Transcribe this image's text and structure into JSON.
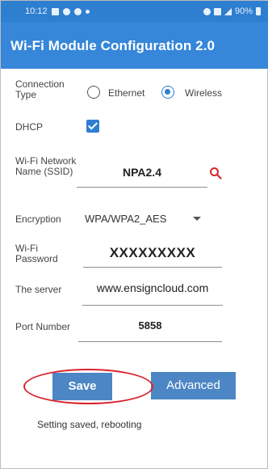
{
  "status_bar": {
    "time": "10:12",
    "battery": "90%"
  },
  "app_bar": {
    "title": "Wi-Fi Module Configuration 2.0"
  },
  "form": {
    "connection_type": {
      "label": "Connection Type",
      "options": [
        "Ethernet",
        "Wireless"
      ],
      "selected": "Wireless"
    },
    "dhcp": {
      "label": "DHCP",
      "checked": true
    },
    "ssid": {
      "label": "Wi-Fi Network Name (SSID)",
      "value": "NPA2.4"
    },
    "encryption": {
      "label": "Encryption",
      "value": "WPA/WPA2_AES"
    },
    "password": {
      "label": "Wi-Fi Password",
      "value": "XXXXXXXXX"
    },
    "server": {
      "label": "The server",
      "value": "www.ensigncloud.com"
    },
    "port": {
      "label": "Port Number",
      "value": "5858"
    }
  },
  "buttons": {
    "save": "Save",
    "advanced": "Advanced"
  },
  "status_message": "Setting saved, rebooting",
  "colors": {
    "app_bar": "#3686d9",
    "button": "#4d86c4",
    "highlight": "#d9232d"
  },
  "icons": {
    "status_bar": [
      "gallery-icon",
      "location-icon",
      "app-icon",
      "dot-icon",
      "alarm-icon",
      "wifi-icon",
      "signal-icon",
      "battery-icon"
    ],
    "ssid_search": "search-icon",
    "encryption_dropdown": "chevron-down-icon"
  }
}
